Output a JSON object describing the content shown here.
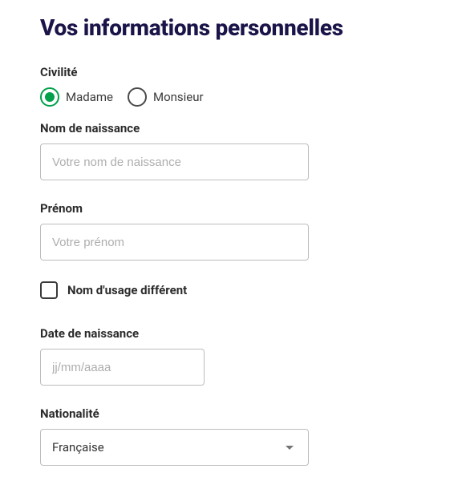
{
  "title": "Vos informations personnelles",
  "civility": {
    "label": "Civilité",
    "options": {
      "madame": "Madame",
      "monsieur": "Monsieur"
    },
    "selected": "madame"
  },
  "birthName": {
    "label": "Nom de naissance",
    "placeholder": "Votre nom de naissance",
    "value": ""
  },
  "firstName": {
    "label": "Prénom",
    "placeholder": "Votre prénom",
    "value": ""
  },
  "differentUsageName": {
    "label": "Nom d'usage différent",
    "checked": false
  },
  "birthDate": {
    "label": "Date de naissance",
    "placeholder": "jj/mm/aaaa",
    "value": ""
  },
  "nationality": {
    "label": "Nationalité",
    "selected": "Française"
  }
}
